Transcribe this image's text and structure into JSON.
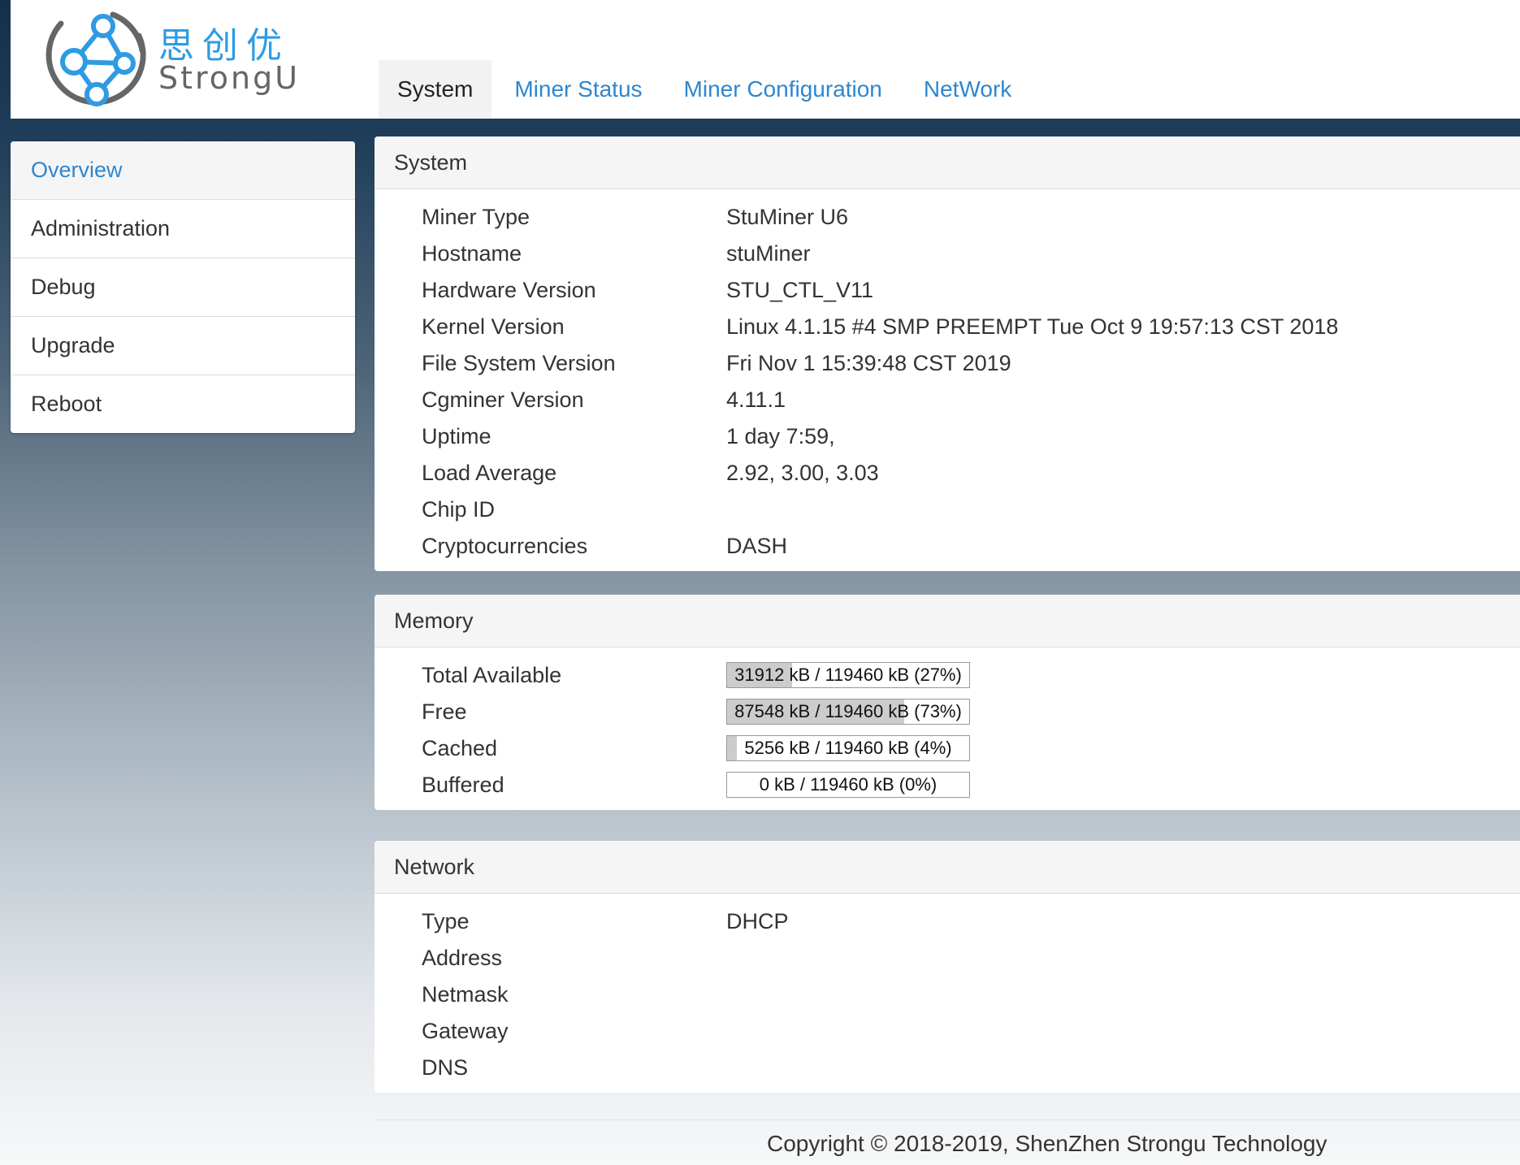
{
  "brand": {
    "name_cn": "思创优",
    "name_en": "StrongU",
    "icon": "molecule-logo-icon",
    "logo_blue": "#2e9be3",
    "logo_gray": "#666666"
  },
  "nav": {
    "tabs": [
      {
        "label": "System",
        "active": true
      },
      {
        "label": "Miner Status",
        "active": false
      },
      {
        "label": "Miner Configuration",
        "active": false
      },
      {
        "label": "NetWork",
        "active": false
      }
    ]
  },
  "sidebar": {
    "items": [
      {
        "label": "Overview",
        "active": true
      },
      {
        "label": "Administration",
        "active": false
      },
      {
        "label": "Debug",
        "active": false
      },
      {
        "label": "Upgrade",
        "active": false
      },
      {
        "label": "Reboot",
        "active": false
      }
    ]
  },
  "system": {
    "title": "System",
    "rows": [
      {
        "label": "Miner Type",
        "value": "StuMiner U6"
      },
      {
        "label": "Hostname",
        "value": "stuMiner"
      },
      {
        "label": "Hardware Version",
        "value": "STU_CTL_V11"
      },
      {
        "label": "Kernel Version",
        "value": "Linux 4.1.15 #4 SMP PREEMPT Tue Oct 9 19:57:13 CST 2018"
      },
      {
        "label": "File System Version",
        "value": "Fri Nov 1 15:39:48 CST 2019"
      },
      {
        "label": "Cgminer Version",
        "value": "4.11.1"
      },
      {
        "label": "Uptime",
        "value": "1 day 7:59,"
      },
      {
        "label": "Load Average",
        "value": "2.92, 3.00, 3.03"
      },
      {
        "label": "Chip ID",
        "value": ""
      },
      {
        "label": "Cryptocurrencies",
        "value": "DASH"
      }
    ]
  },
  "memory": {
    "title": "Memory",
    "rows": [
      {
        "label": "Total Available",
        "text": "31912 kB / 119460 kB (27%)",
        "percent": 27
      },
      {
        "label": "Free",
        "text": "87548 kB / 119460 kB (73%)",
        "percent": 73
      },
      {
        "label": "Cached",
        "text": "5256 kB / 119460 kB (4%)",
        "percent": 4
      },
      {
        "label": "Buffered",
        "text": "0 kB / 119460 kB (0%)",
        "percent": 0
      }
    ]
  },
  "network": {
    "title": "Network",
    "rows": [
      {
        "label": "Type",
        "value": "DHCP"
      },
      {
        "label": "Address",
        "value": ""
      },
      {
        "label": "Netmask",
        "value": ""
      },
      {
        "label": "Gateway",
        "value": ""
      },
      {
        "label": "DNS",
        "value": ""
      }
    ]
  },
  "footer": {
    "copyright": "Copyright © 2018-2019, ShenZhen Strongu Technology"
  }
}
